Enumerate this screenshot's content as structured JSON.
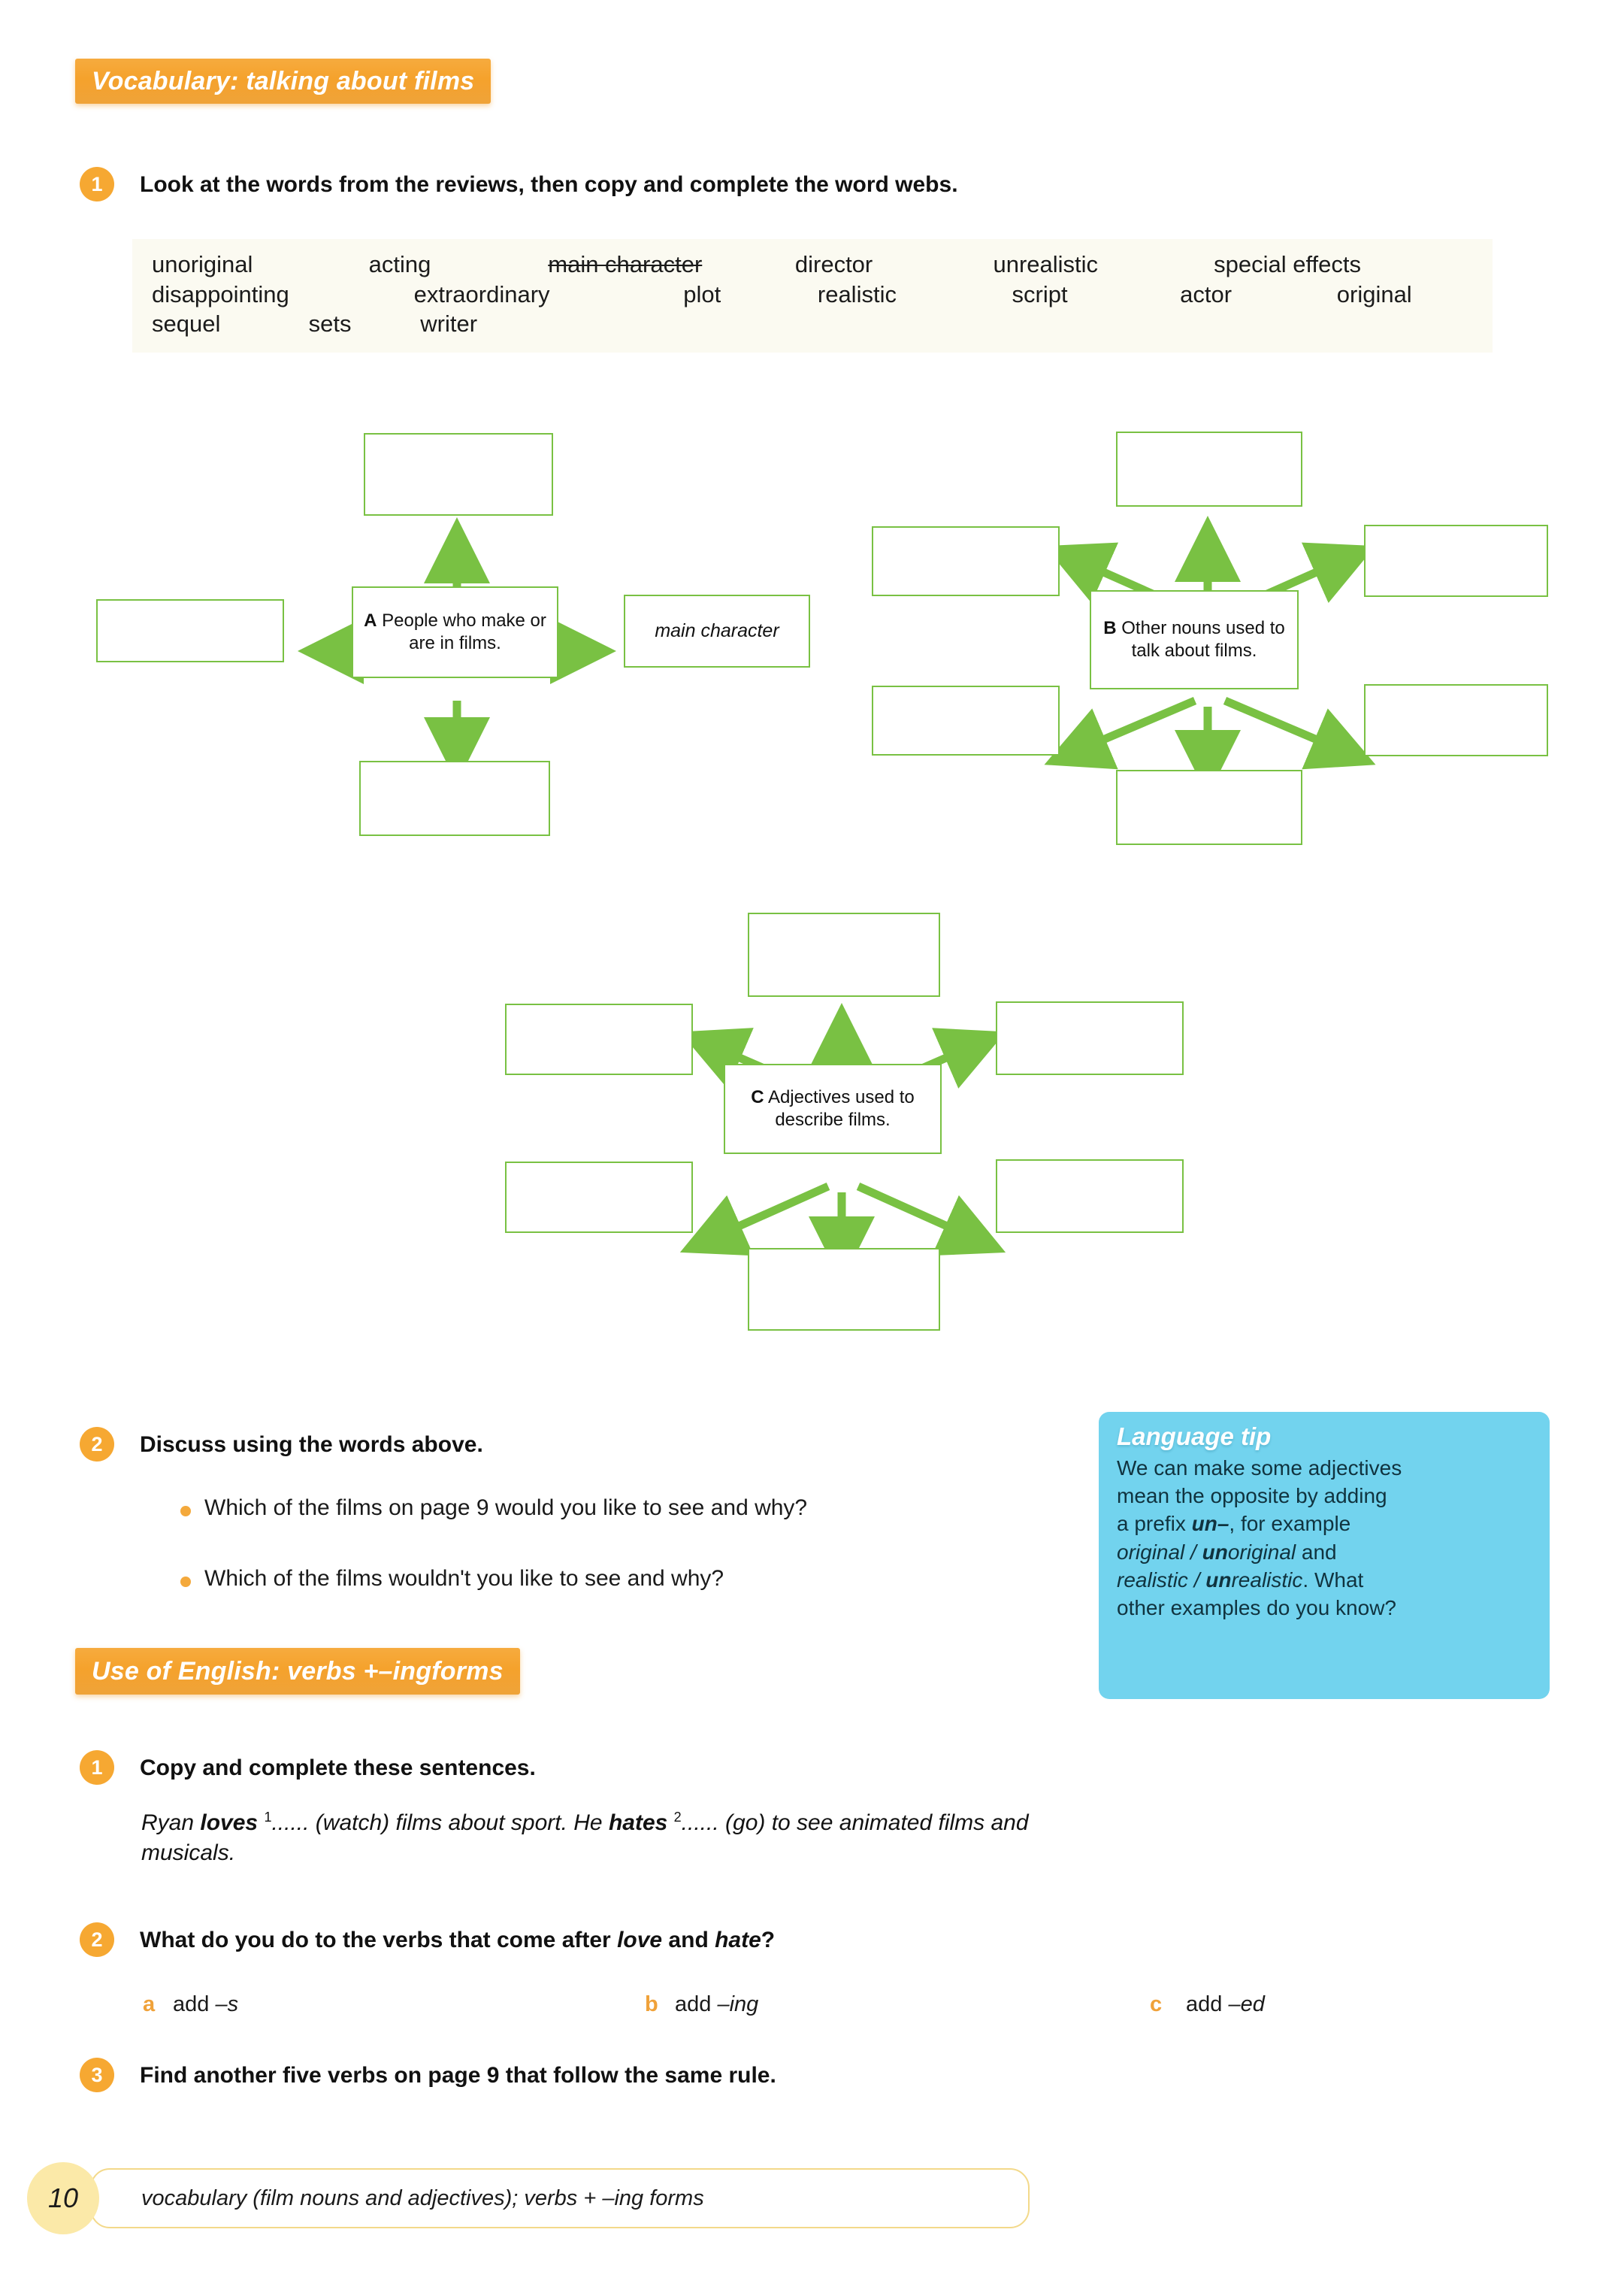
{
  "sections": {
    "vocabulary_banner": "Vocabulary: talking about films",
    "use_of_english_banner_part1": "Use of English: verbs + ",
    "use_of_english_banner_part2": "–ing",
    "use_of_english_banner_part3": " forms"
  },
  "exercise1": {
    "number": "1",
    "instruction": "Look at the words from the reviews, then copy and complete the word webs.",
    "wordbank": {
      "row1": [
        "unoriginal",
        "acting",
        "main character",
        "director",
        "unrealistic",
        "special effects"
      ],
      "row2": [
        "disappointing",
        "extraordinary",
        "plot",
        "realistic",
        "script",
        "actor",
        "original"
      ],
      "row3": [
        "sequel",
        "sets",
        "writer"
      ],
      "struck_word": "main character"
    }
  },
  "webs": [
    {
      "id": "A",
      "letter": "A",
      "center_text": "People who make or are in films.",
      "satellites": [
        {
          "position": "top",
          "label": ""
        },
        {
          "position": "left",
          "label": ""
        },
        {
          "position": "right",
          "label": "main character"
        },
        {
          "position": "bottom",
          "label": ""
        }
      ]
    },
    {
      "id": "B",
      "letter": "B",
      "center_text": "Other nouns used to talk about films.",
      "satellites": [
        {
          "position": "top",
          "label": ""
        },
        {
          "position": "upper-left",
          "label": ""
        },
        {
          "position": "upper-right",
          "label": ""
        },
        {
          "position": "lower-left",
          "label": ""
        },
        {
          "position": "lower-right",
          "label": ""
        },
        {
          "position": "bottom",
          "label": ""
        }
      ]
    },
    {
      "id": "C",
      "letter": "C",
      "center_text": "Adjectives used to describe films.",
      "satellites": [
        {
          "position": "top",
          "label": ""
        },
        {
          "position": "upper-left",
          "label": ""
        },
        {
          "position": "upper-right",
          "label": ""
        },
        {
          "position": "lower-left",
          "label": ""
        },
        {
          "position": "lower-right",
          "label": ""
        },
        {
          "position": "bottom",
          "label": ""
        }
      ]
    }
  ],
  "exercise2_discuss": {
    "number": "2",
    "instruction": "Discuss using the words above.",
    "bullets": [
      "Which of the films on page 9 would you like to see and why?",
      "Which of the films wouldn't you like to see and why?"
    ]
  },
  "language_tip": {
    "title": "Language tip",
    "line1": "We can make some adjectives",
    "line2": "mean the opposite by adding",
    "line3_a": "a prefix ",
    "line3_b": "un–",
    "line3_c": ", for example",
    "line4_a": "original",
    "line4_b": " / ",
    "line4_c": "un",
    "line4_d": "original",
    "line4_e": " and",
    "line5_a": "realistic",
    "line5_b": " / ",
    "line5_c": "un",
    "line5_d": "realistic",
    "line5_e": ". What",
    "line6": "other examples do you know?"
  },
  "use_of_english": {
    "ex1": {
      "number": "1",
      "instruction": "Copy and complete these sentences.",
      "sentence_parts": {
        "p1": "Ryan ",
        "verb1": "loves",
        "sup1": "1",
        "p2": "...... (watch) films about sport. He ",
        "verb2": "hates",
        "sup2": "2",
        "p3": "...... (go) to see animated films and",
        "p4": "musicals."
      }
    },
    "ex2": {
      "number": "2",
      "instruction_a": "What do you do to the verbs that come after ",
      "instruction_love": "love",
      "instruction_and": " and ",
      "instruction_hate": "hate",
      "instruction_q": "?",
      "options": [
        {
          "label": "a",
          "text_plain": "add ",
          "text_italic": "–s"
        },
        {
          "label": "b",
          "text_plain": "add ",
          "text_italic": "–ing"
        },
        {
          "label": "c",
          "text_plain": "add ",
          "text_italic": "–ed"
        }
      ]
    },
    "ex3": {
      "number": "3",
      "instruction": "Find another five verbs on page 9 that follow the same rule."
    }
  },
  "footer": {
    "page_number": "10",
    "caption": "vocabulary (film nouns and adjectives); verbs + –ing forms"
  },
  "colors": {
    "banner_orange": "#f5a22c",
    "circle_orange": "#f6a832",
    "web_green": "#79c143",
    "tip_blue": "#72d3ee",
    "footer_yellow": "#fbe9a8"
  }
}
